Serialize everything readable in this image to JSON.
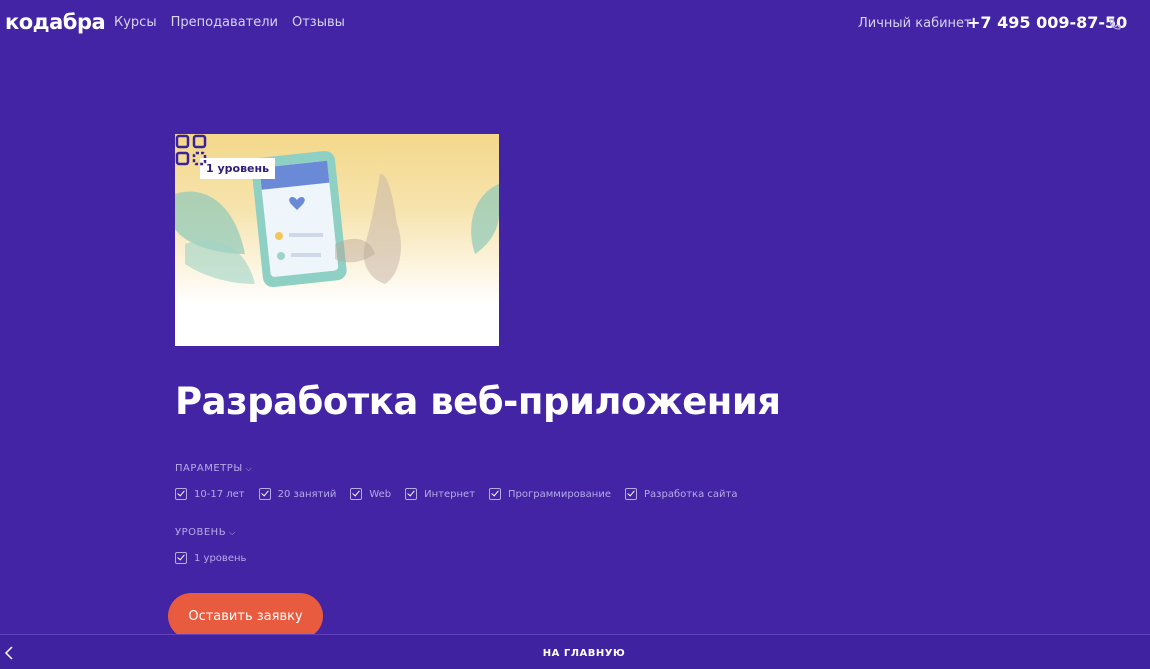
{
  "header": {
    "logo": "кодабра",
    "nav": [
      "Курсы",
      "Преподаватели",
      "Отзывы"
    ],
    "account": "Личный кабинет",
    "phone": "+7 495 009-87-50"
  },
  "course": {
    "level_badge": "1 уровень",
    "title": "Разработка веб-приложения"
  },
  "params": {
    "label": "ПАРАМЕТРЫ",
    "items": [
      "10-17 лет",
      "20 занятий",
      "Web",
      "Интернет",
      "Программирование",
      "Разработка сайта"
    ]
  },
  "level": {
    "label": "УРОВЕНЬ",
    "items": [
      "1 уровень"
    ]
  },
  "cta": {
    "label": "Оставить заявку"
  },
  "bottom": {
    "home": "НА ГЛАВНУЮ"
  },
  "colors": {
    "background": "#4224a5",
    "accent": "#e85b3f"
  }
}
